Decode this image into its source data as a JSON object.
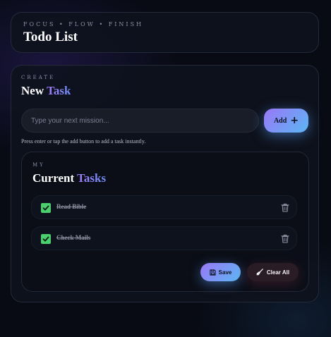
{
  "header": {
    "eyebrow": "FOCUS • FLOW • FINISH",
    "title": "Todo List"
  },
  "create": {
    "eyebrow": "CREATE",
    "title_plain": "New",
    "title_accent": "Task",
    "input_placeholder": "Type your next mission...",
    "input_value": "",
    "add_label": "Add",
    "add_icon": "plus-icon",
    "helper": "Press enter or tap the add button to add a task instantly."
  },
  "tasks": {
    "eyebrow": "MY",
    "title_plain": "Current",
    "title_accent": "Tasks",
    "items": [
      {
        "label": "Read Bible",
        "done": true
      },
      {
        "label": "Check Mails",
        "done": true
      }
    ],
    "save_label": "Save",
    "save_icon": "floppy-disk-icon",
    "clear_label": "Clear All",
    "clear_icon": "broom-icon"
  },
  "colors": {
    "accent_start": "#9a77f7",
    "accent_end": "#5bb6f3",
    "check_green": "#4ccf6e",
    "background": "#080b14"
  }
}
